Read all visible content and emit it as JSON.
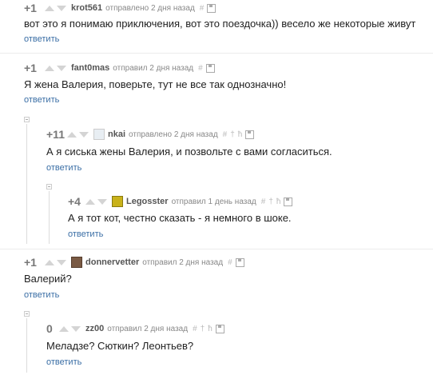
{
  "reply_label": "ответить",
  "comments": [
    {
      "rating": "+1",
      "user": "krot561",
      "meta": "отправлено 2 дня назад",
      "text": "вот это я понимаю приключения, вот это поездочка)) весело же некоторые живут"
    },
    {
      "rating": "+1",
      "user": "fant0mas",
      "meta": "отправил 2 дня назад",
      "text": "Я жена Валерия, поверьте, тут не все так однозначно!"
    },
    {
      "rating": "+11",
      "user": "nkai",
      "meta": "отправлено 2 дня назад",
      "text": "А я сиська жены Валерия, и позвольте с вами согласиться."
    },
    {
      "rating": "+4",
      "user": "Legosster",
      "meta": "отправил 1 день назад",
      "text": "А я тот кот, честно сказать - я немного в шоке."
    },
    {
      "rating": "+1",
      "user": "donnervetter",
      "meta": "отправил 2 дня назад",
      "text": "Валерий?"
    },
    {
      "rating": "0",
      "user": "zz00",
      "meta": "отправил 2 дня назад",
      "text": "Меладзе? Сюткин? Леонтьев?"
    }
  ],
  "icons": [
    "arrow-up-icon",
    "arrow-down-icon",
    "hash-icon",
    "save-icon",
    "plus-icon",
    "figure-icon",
    "avatar"
  ]
}
